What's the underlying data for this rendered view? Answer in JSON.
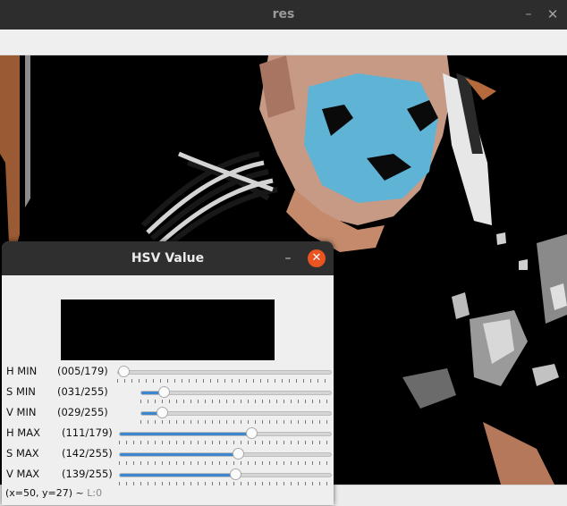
{
  "main_window": {
    "title": "res",
    "min_glyph": "–",
    "close_glyph": "✕"
  },
  "hsv_window": {
    "title": "HSV Value",
    "min_glyph": "–",
    "close_glyph": "✕",
    "trackbars": [
      {
        "name": "H MIN",
        "value_text": "(005/179)",
        "value": 5,
        "max": 179
      },
      {
        "name": "S MIN",
        "value_text": "(031/255)",
        "value": 31,
        "max": 255
      },
      {
        "name": "V MIN",
        "value_text": "(029/255)",
        "value": 29,
        "max": 255
      },
      {
        "name": "H MAX",
        "value_text": "(111/179)",
        "value": 111,
        "max": 179
      },
      {
        "name": "S MAX",
        "value_text": "(142/255)",
        "value": 142,
        "max": 255
      },
      {
        "name": "V MAX",
        "value_text": "(139/255)",
        "value": 139,
        "max": 255
      }
    ],
    "status": {
      "coords": "(x=50, y=27) ~",
      "level": "L:0"
    }
  },
  "colors": {
    "slider_fill": "#3d86d0",
    "close_button": "#e95420",
    "titlebar": "#2f2f2f"
  }
}
